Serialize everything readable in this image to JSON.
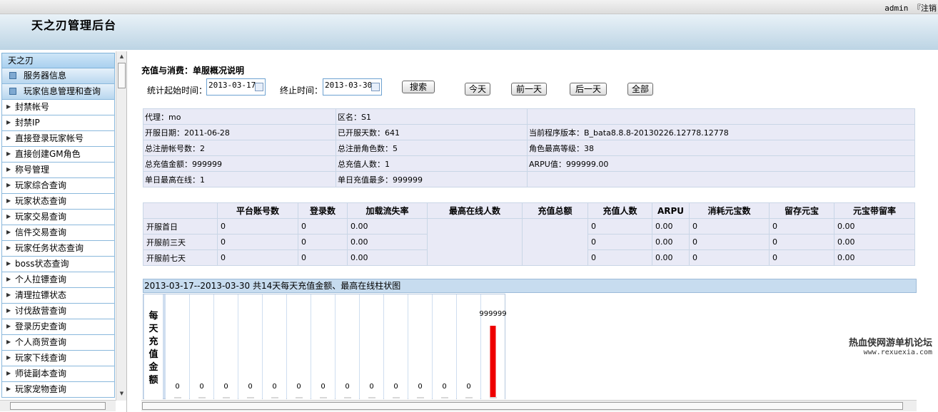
{
  "header": {
    "admin_user": "admin",
    "logout_label": "注销",
    "app_title": "天之刃管理后台"
  },
  "sidebar": {
    "title": "天之刃",
    "groups": [
      {
        "label": "服务器信息"
      },
      {
        "label": "玩家信息管理和查询"
      }
    ],
    "items": [
      {
        "label": "封禁帐号"
      },
      {
        "label": "封禁IP"
      },
      {
        "label": "直接登录玩家帐号"
      },
      {
        "label": "直接创建GM角色"
      },
      {
        "label": "称号管理"
      },
      {
        "label": "玩家综合查询"
      },
      {
        "label": "玩家状态查询"
      },
      {
        "label": "玩家交易查询"
      },
      {
        "label": "信件交易查询"
      },
      {
        "label": "玩家任务状态查询"
      },
      {
        "label": "boss状态查询"
      },
      {
        "label": "个人拉镖查询"
      },
      {
        "label": "清理拉镖状态"
      },
      {
        "label": "讨伐敌营查询"
      },
      {
        "label": "登录历史查询"
      },
      {
        "label": "个人商贸查询"
      },
      {
        "label": "玩家下线查询"
      },
      {
        "label": "师徒副本查询"
      },
      {
        "label": "玩家宠物查询"
      }
    ]
  },
  "main": {
    "section_title": "充值与消费：单服概况说明",
    "start_label": "统计起始时间：",
    "start_value": "2013-03-17",
    "end_label": "终止时间：",
    "end_value": "2013-03-30",
    "search_label": "搜索",
    "today_label": "今天",
    "prev_day_label": "前一天",
    "next_day_label": "后一天",
    "all_label": "全部"
  },
  "info": {
    "agent": "代理：mo",
    "zone": "区名：S1",
    "open_date": "开服日期：2011-06-28",
    "open_days": "已开服天数：641",
    "version": "当前程序版本：B_bata8.8.8-20130226.12778.12778",
    "total_accounts": "总注册帐号数：2",
    "total_roles": "总注册角色数：5",
    "max_level": "角色最高等级：38",
    "total_pay": "总充值金额：999999",
    "total_payers": "总充值人数：1",
    "arpu": "ARPU值：999999.00",
    "max_online": "单日最高在线：1",
    "max_daily_pay": "单日充值最多：999999"
  },
  "stats": {
    "headers": [
      "平台账号数",
      "登录数",
      "加载流失率",
      "最高在线人数",
      "充值总额",
      "充值人数",
      "ARPU",
      "消耗元宝数",
      "留存元宝",
      "元宝带留率"
    ],
    "rows": [
      {
        "label": "开服首日",
        "accounts": "0",
        "logins": "0",
        "loss": "0.00",
        "payers": "0",
        "arpu": "0.00",
        "used": "0",
        "remain": "0",
        "rate": "0.00"
      },
      {
        "label": "开服前三天",
        "accounts": "0",
        "logins": "0",
        "loss": "0.00",
        "payers": "0",
        "arpu": "0.00",
        "used": "0",
        "remain": "0",
        "rate": "0.00"
      },
      {
        "label": "开服前七天",
        "accounts": "0",
        "logins": "0",
        "loss": "0.00",
        "payers": "0",
        "arpu": "0.00",
        "used": "0",
        "remain": "0",
        "rate": "0.00"
      }
    ]
  },
  "chart_caption": "2013-03-17--2013-03-30 共14天每天充值金额、最高在线柱状图",
  "chart_data": {
    "type": "bar",
    "ylabel": "每天充值金额",
    "values": [
      0,
      0,
      0,
      0,
      0,
      0,
      0,
      0,
      0,
      0,
      0,
      0,
      0,
      999999
    ],
    "value_labels": [
      "0",
      "0",
      "0",
      "0",
      "0",
      "0",
      "0",
      "0",
      "0",
      "0",
      "0",
      "0",
      "0",
      "999999"
    ],
    "bar_color": "#ee0000"
  },
  "watermark": {
    "line1": "热血侠网游单机论坛",
    "line2": "www.rexuexia.com"
  }
}
